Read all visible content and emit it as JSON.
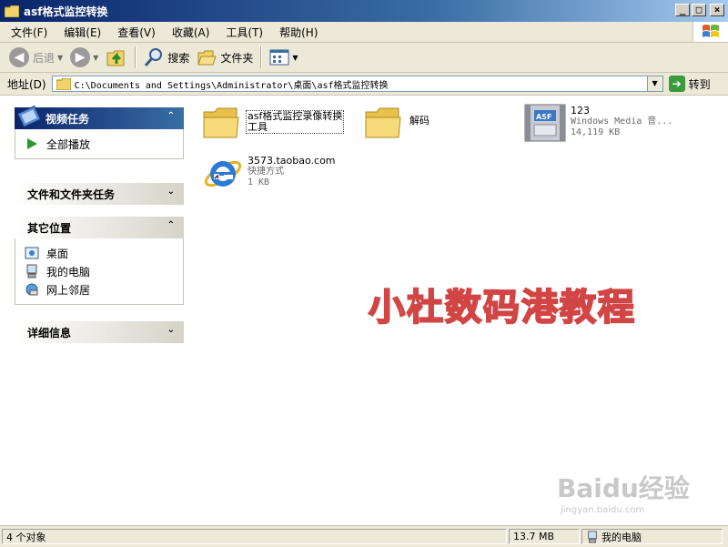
{
  "window": {
    "title": "asf格式监控转换"
  },
  "menu": [
    "文件(F)",
    "编辑(E)",
    "查看(V)",
    "收藏(A)",
    "工具(T)",
    "帮助(H)"
  ],
  "toolbar": {
    "back": "后退",
    "search": "搜索",
    "folders": "文件夹"
  },
  "address": {
    "label": "地址(D)",
    "path": "C:\\Documents and Settings\\Administrator\\桌面\\asf格式监控转换",
    "go": "转到"
  },
  "tasks": {
    "video": {
      "title": "视频任务",
      "items": [
        "全部播放"
      ]
    },
    "file_folder": {
      "title": "文件和文件夹任务"
    },
    "other": {
      "title": "其它位置",
      "items": [
        "桌面",
        "我的电脑",
        "网上邻居"
      ]
    },
    "details": {
      "title": "详细信息"
    }
  },
  "files": [
    {
      "name_line1": "asf格式监控录像转换",
      "name_line2": "工具"
    },
    {
      "name": "解码"
    },
    {
      "name": "123",
      "type": "Windows Media 音...",
      "size": "14,119 KB",
      "icon_label": "ASF"
    },
    {
      "name": "3573.taobao.com",
      "type": "快捷方式",
      "size": "1 KB"
    }
  ],
  "watermark": {
    "text": "小杜数码港教程",
    "baidu": "Baidu经验",
    "baidu_sub": "jingyan.baidu.com"
  },
  "status": {
    "objects": "4 个对象",
    "size": "13.7 MB",
    "location": "我的电脑"
  },
  "colors": {
    "titlebar": "#0a246a",
    "task_header": "#0a246a",
    "watermark": "#d24545"
  }
}
